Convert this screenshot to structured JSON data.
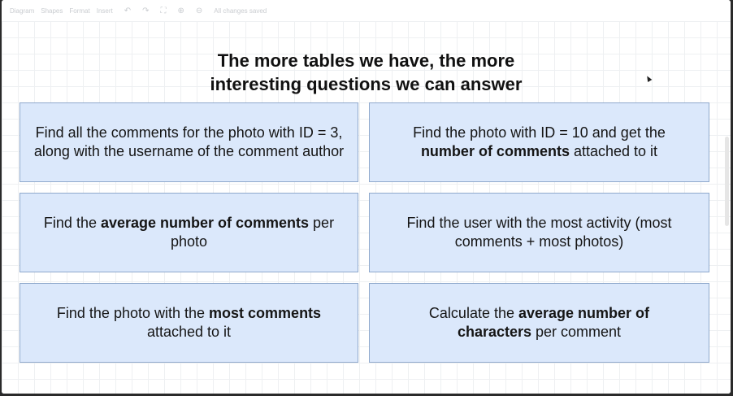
{
  "toolbar": {
    "items": [
      "Diagram",
      "Shapes",
      "Format",
      "Insert"
    ],
    "status": "All changes saved",
    "undo_icon": "undo-icon",
    "zoom_icons": [
      "fit-icon",
      "zoom-in-icon",
      "zoom-out-icon"
    ]
  },
  "slide": {
    "title_line1": "The more tables we have, the more",
    "title_line2": "interesting questions we can answer"
  },
  "cards": [
    {
      "pre": "Find all the comments for the photo with ID = 3, along with the username of the comment author",
      "bold": "",
      "post": ""
    },
    {
      "pre": "Find the photo with ID = 10 and get the ",
      "bold": "number of comments",
      "post": " attached to it"
    },
    {
      "pre": "Find the ",
      "bold": "average number of comments",
      "post": " per photo"
    },
    {
      "pre": "Find the user with the most activity (most comments + most photos)",
      "bold": "",
      "post": ""
    },
    {
      "pre": "Find the photo with the ",
      "bold": "most comments",
      "post": " attached to it"
    },
    {
      "pre": "Calculate the ",
      "bold": "average number of characters",
      "post": " per comment"
    }
  ],
  "colors": {
    "card_fill": "#dbe8fb",
    "card_border": "#8fa9cc",
    "title_text": "#111111"
  }
}
